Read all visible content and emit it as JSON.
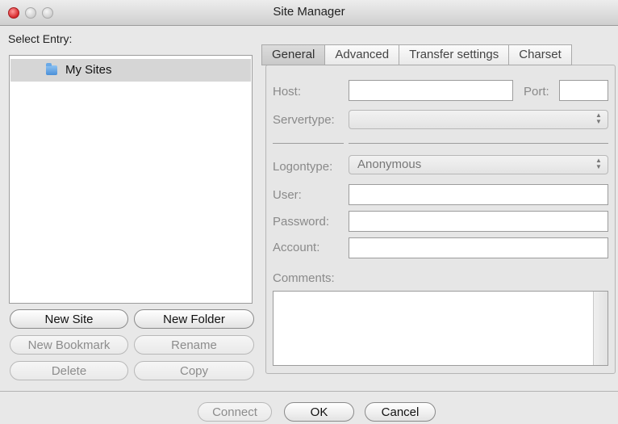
{
  "window": {
    "title": "Site Manager"
  },
  "left": {
    "select_label": "Select Entry:",
    "tree": [
      {
        "label": "My Sites",
        "icon": "folder-icon",
        "selected": true
      }
    ],
    "buttons": {
      "new_site": "New Site",
      "new_folder": "New Folder",
      "new_bookmark": "New Bookmark",
      "rename": "Rename",
      "delete": "Delete",
      "copy": "Copy"
    }
  },
  "tabs": [
    {
      "label": "General",
      "active": true
    },
    {
      "label": "Advanced",
      "active": false
    },
    {
      "label": "Transfer settings",
      "active": false
    },
    {
      "label": "Charset",
      "active": false
    }
  ],
  "general": {
    "host_label": "Host:",
    "host_value": "",
    "port_label": "Port:",
    "port_value": "",
    "servertype_label": "Servertype:",
    "servertype_value": "",
    "logontype_label": "Logontype:",
    "logontype_value": "Anonymous",
    "user_label": "User:",
    "user_value": "",
    "password_label": "Password:",
    "password_value": "",
    "account_label": "Account:",
    "account_value": "",
    "comments_label": "Comments:",
    "comments_value": ""
  },
  "footer": {
    "connect": "Connect",
    "ok": "OK",
    "cancel": "Cancel"
  }
}
